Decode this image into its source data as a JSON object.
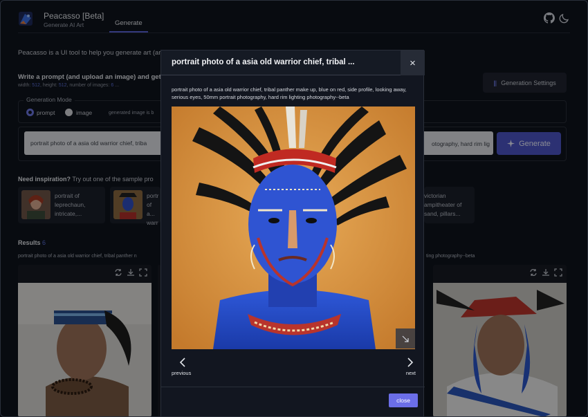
{
  "app": {
    "title": "Peacasso [Beta]",
    "subtitle": "Generate AI Art",
    "nav_tab": "Generate"
  },
  "intro": "Peacasso is a UI tool to help you generate art (ar",
  "prompt_section": {
    "heading": "Write a prompt (and upload an image) and get",
    "meta_width_label": "width:",
    "meta_width": "512",
    "meta_height_label": ", height:",
    "meta_height": "512",
    "meta_images_label": ", number of images:",
    "meta_images": "6",
    "meta_tail": " ...",
    "settings_button": "Generation Settings"
  },
  "generation_mode": {
    "legend": "Generation Mode",
    "options": [
      "prompt",
      "image"
    ],
    "selected": "prompt",
    "note": "generated image is b"
  },
  "prompt_input": {
    "value": "portrait photo of a asia old warrior chief, triba",
    "value_tail": "otography, hard rim lig",
    "generate_label": "Generate"
  },
  "inspiration": {
    "lead": "Need inspiration?",
    "text": " Try out one of the sample pro",
    "samples": [
      {
        "text": "portrait of leprechaun, intricate,..."
      },
      {
        "text": "portr of a... warr"
      },
      {
        "text": "victorian ampitheater of sand, pillars..."
      }
    ]
  },
  "results": {
    "title": "Results",
    "count": "6",
    "prompt_head": "portrait photo of a asia old warrior chief, tribal panther n",
    "prompt_tail": "ting photography--beta"
  },
  "modal": {
    "title": "portrait photo of a asia old warrior chief, tribal ...",
    "prompt": "portrait photo of a asia old warrior chief, tribal panther make up, blue on red, side profile, looking away, serious eyes, 50mm portrait photography, hard rim lighting photography--beta",
    "previous": "previous",
    "next": "next",
    "close": "close",
    "close_icon": "×"
  },
  "colors": {
    "accent": "#5a63d8",
    "generate_button": "#4c55c6",
    "close_button": "#6b6ee8",
    "background": "#0f131c"
  },
  "icons": [
    "logo-icon",
    "github-icon",
    "moon-icon",
    "sliders-icon",
    "sparkle-icon",
    "refresh-icon",
    "download-icon",
    "expand-icon",
    "close-icon",
    "chevron-left-icon",
    "chevron-right-icon"
  ]
}
